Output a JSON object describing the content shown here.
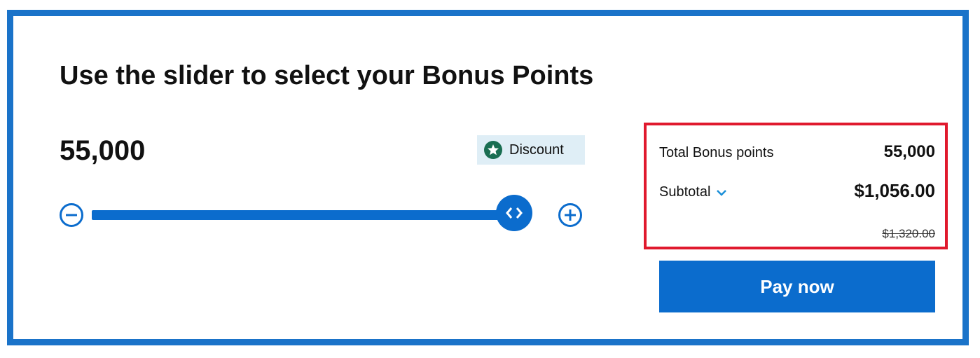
{
  "heading": "Use the slider to select your Bonus Points",
  "points_display": "55,000",
  "discount_badge": {
    "label": "Discount",
    "icon": "star-icon",
    "icon_color": "#1a6e52"
  },
  "slider": {
    "level": 0.92,
    "decrease_icon": "minus-circle-icon",
    "increase_icon": "plus-circle-icon",
    "thumb_icon": "chevron-left-right-icon",
    "color": "#0b6ccd"
  },
  "summary": {
    "total_label": "Total Bonus points",
    "total_value": "55,000",
    "subtotal_label": "Subtotal",
    "subtotal_value": "$1,056.00",
    "original_price": "$1,320.00",
    "highlight_color": "#e0192d"
  },
  "pay_button": {
    "label": "Pay now",
    "color": "#0b6ccd"
  },
  "frame_color": "#1a73c9"
}
